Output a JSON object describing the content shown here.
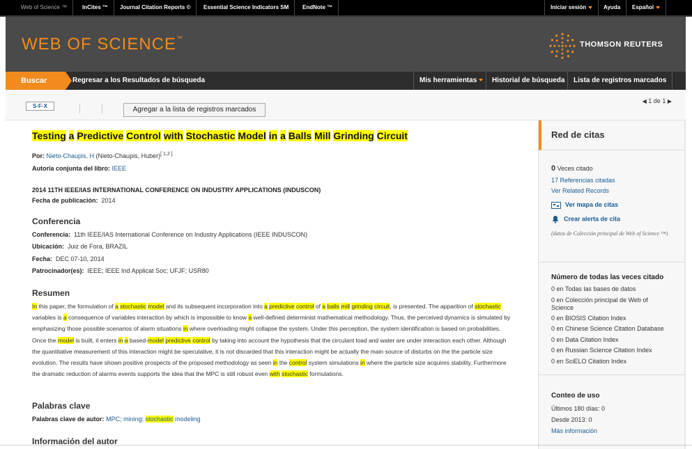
{
  "topbar": {
    "links": [
      "Web of Science ™",
      "InCites ™",
      "Journal Citation Reports ©",
      "Essential Science Indicators SM",
      "EndNote ™"
    ],
    "signin": "Iniciar sesión",
    "help": "Ayuda",
    "language": "Español"
  },
  "header": {
    "logo": "WEB OF SCIENCE",
    "logo_tm": "™",
    "brand": "THOMSON REUTERS",
    "brand_tm": "®"
  },
  "nav": {
    "search": "Buscar",
    "back": "Regresar a los Resultados de búsqueda",
    "tools": "Mis herramientas",
    "history": "Historial de búsqueda",
    "marked": "Lista de registros marcados"
  },
  "toolbar": {
    "sfx_left": "S",
    "sfx_right": "S·F·X",
    "add_marked": "Agregar a la lista de registros marcados",
    "pager": "1  de  1"
  },
  "record": {
    "title_parts": [
      {
        "t": "Testing",
        "h": true
      },
      {
        "t": " ",
        "h": false
      },
      {
        "t": "a",
        "h": true
      },
      {
        "t": " ",
        "h": false
      },
      {
        "t": "Predictive",
        "h": true
      },
      {
        "t": " ",
        "h": false
      },
      {
        "t": "Control",
        "h": true
      },
      {
        "t": " ",
        "h": false
      },
      {
        "t": "with",
        "h": true
      },
      {
        "t": " ",
        "h": false
      },
      {
        "t": "Stochastic",
        "h": true
      },
      {
        "t": " ",
        "h": false
      },
      {
        "t": "Model",
        "h": true
      },
      {
        "t": " ",
        "h": false
      },
      {
        "t": "in",
        "h": true
      },
      {
        "t": " ",
        "h": false
      },
      {
        "t": "a",
        "h": true
      },
      {
        "t": " ",
        "h": false
      },
      {
        "t": "Balls",
        "h": true
      },
      {
        "t": " ",
        "h": false
      },
      {
        "t": "Mill",
        "h": true
      },
      {
        "t": " ",
        "h": false
      },
      {
        "t": "Grinding",
        "h": true
      },
      {
        "t": " ",
        "h": false
      },
      {
        "t": "Circuit",
        "h": true
      }
    ],
    "by_label": "Por:",
    "author": "Nieto-Chaupis, H",
    "author_full": " (Nieto-Chaupis, Huber)",
    "author_sup": "[ 1,2 ]",
    "corp_label": "Autoría conjunta del libro:",
    "corp": "IEEE",
    "conf_series": "2014 11TH IEEE/IAS INTERNATIONAL CONFERENCE ON INDUSTRY APPLICATIONS (INDUSCON)",
    "pub_date_label": "Fecha de publicación:",
    "pub_date": "2014",
    "conf_heading": "Conferencia",
    "conf_label": "Conferencia:",
    "conf": "11th IEEE/IAS International Conference on Industry Applications (IEEE INDUSCON)",
    "loc_label": "Ubicación:",
    "loc": "Juiz de Fora, BRAZIL",
    "date_label": "Fecha:",
    "date": "DEC 07-10, 2014",
    "sponsor_label": "Patrocinador(es):",
    "sponsor": "IEEE; IEEE Ind Applicat Soc; UFJF; USR80",
    "abstract_heading": "Resumen",
    "abstract_parts": [
      {
        "t": "In",
        "h": true
      },
      {
        "t": " this paper, the formulation of ",
        "h": false
      },
      {
        "t": "a",
        "h": true
      },
      {
        "t": " ",
        "h": false
      },
      {
        "t": "stochastic",
        "h": true
      },
      {
        "t": " ",
        "h": false
      },
      {
        "t": "model",
        "h": true
      },
      {
        "t": " and its subsequent incorporation into ",
        "h": false
      },
      {
        "t": "a",
        "h": true
      },
      {
        "t": " ",
        "h": false
      },
      {
        "t": "predictive",
        "h": true
      },
      {
        "t": " ",
        "h": false
      },
      {
        "t": "control",
        "h": true
      },
      {
        "t": " of ",
        "h": false
      },
      {
        "t": "a",
        "h": true
      },
      {
        "t": " ",
        "h": false
      },
      {
        "t": "balls",
        "h": true
      },
      {
        "t": " ",
        "h": false
      },
      {
        "t": "mill",
        "h": true
      },
      {
        "t": " ",
        "h": false
      },
      {
        "t": "grinding",
        "h": true
      },
      {
        "t": " ",
        "h": false
      },
      {
        "t": "circuit",
        "h": true
      },
      {
        "t": ", is presented. The apparition of ",
        "h": false
      },
      {
        "t": "stochastic",
        "h": true
      },
      {
        "t": " variables is ",
        "h": false
      },
      {
        "t": "a",
        "h": true
      },
      {
        "t": " consequence of variables interaction by which is impossible to know ",
        "h": false
      },
      {
        "t": "a",
        "h": true
      },
      {
        "t": " well-defined determinist mathematical methodology. Thus, the perceived dynamics is simulated by emphasizing those possible scenarios of alarm situations ",
        "h": false
      },
      {
        "t": "in",
        "h": true
      },
      {
        "t": " where overloading might collapse the system. Under this perception, the system identification is based on probabilities. Once the ",
        "h": false
      },
      {
        "t": "model",
        "h": true
      },
      {
        "t": " is built, it enters ",
        "h": false
      },
      {
        "t": "in",
        "h": true
      },
      {
        "t": " ",
        "h": false
      },
      {
        "t": "a",
        "h": true
      },
      {
        "t": " based-",
        "h": false
      },
      {
        "t": "model",
        "h": true
      },
      {
        "t": " ",
        "h": false
      },
      {
        "t": "predictive",
        "h": true
      },
      {
        "t": " ",
        "h": false
      },
      {
        "t": "control",
        "h": true
      },
      {
        "t": " by taking into account the hypothesis that the circulant load and water are under interaction each other. Although the quantitative measurement of this interaction might be speculative, it is not discarded that this interaction might be actually the main source of disturbs on the the particle size evolution. The results have shown positive prospects of the proposed methodology as seen ",
        "h": false
      },
      {
        "t": "in",
        "h": true
      },
      {
        "t": " the ",
        "h": false
      },
      {
        "t": "control",
        "h": true
      },
      {
        "t": " system simulations ",
        "h": false
      },
      {
        "t": "in",
        "h": true
      },
      {
        "t": " where the particle size acquires stability. Furthermore the dramatic reduction of alarms events supports the idea that the MPC is still robust even ",
        "h": false
      },
      {
        "t": "with",
        "h": true
      },
      {
        "t": " ",
        "h": false
      },
      {
        "t": "stochastic",
        "h": true
      },
      {
        "t": " formulations.",
        "h": false
      }
    ],
    "keywords_heading": "Palabras clave",
    "keywords_label": "Palabras clave de autor:",
    "keywords_a": "MPC; mining; ",
    "keywords_hl": "stochastic",
    "keywords_b": " modeling",
    "author_info_heading": "Información del autor"
  },
  "sidebar": {
    "heading": "Red de citas",
    "times_cited_num": "0",
    "times_cited_label": " Veces citado",
    "refs": "17 Referencias citadas",
    "related": "Ver Related Records",
    "map": "Ver mapa de citas",
    "alert": "Crear alerta de cita",
    "note": "(datos de Colección principal de Web of Science ™)",
    "all_heading": "Número de todas las veces citado",
    "all_items": [
      "0 en Todas las bases de datos",
      "0 en Colección principal de Web of Science",
      "0 en BIOSIS Citation Index",
      "0 en Chinese Science Citation Database",
      "0 en Data Citation Index",
      "0 en Russian Science Citation Index",
      "0 en SciELO Citation Index"
    ],
    "usage_heading": "Conteo de uso",
    "usage_180": "Últimos 180 días: 0",
    "usage_2013": "Desde 2013: 0",
    "more_info": "Más información"
  }
}
